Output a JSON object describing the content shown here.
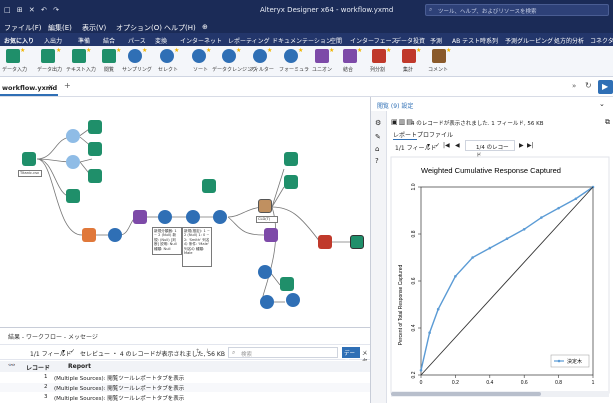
{
  "app": {
    "window_title": "Alteryx Designer x64 - workflow.yxmd",
    "search_placeholder": "ツール、ヘルプ、およびリソースを検索"
  },
  "menu": [
    "ファイル(F)",
    "編集(E)",
    "表示(V)",
    "オプション(O)",
    "ヘルプ(H)"
  ],
  "ribbon_tabs": [
    "お気に入り",
    "入出力",
    "準備",
    "結合",
    "パース",
    "変換",
    "インターネット",
    "レポーティング",
    "ドキュメンテーション",
    "空間",
    "インターフェース",
    "データ投資",
    "予測",
    "AB テスト",
    "時系列",
    "予測グルーピング",
    "処方的分析",
    "コネクター"
  ],
  "palette_tools": [
    "データ入力",
    "データ出力",
    "テキスト入力",
    "閲覧",
    "サンプリング",
    "セレクト",
    "ソート",
    "データクレンジング",
    "フィルター",
    "フォーミュラ",
    "ユニオン",
    "結合",
    "列分割",
    "集計",
    "コメント"
  ],
  "doc_tab": "workflow.yxmd",
  "canvas": {
    "input_node_label": "Titanic.csv",
    "annotation_1": "新規分類器: 1 ~ 2 (Null) 新規: (Null) [判断] 説明: Null 種類: Null",
    "annotation_2": "新規(推定): 1 ~ 2 (Null) 1: 0 ~ 2: 'Smith' 列名の 条件: 'Male' 列名の 種類: Male",
    "annotation_3": "CLD(T)"
  },
  "results": {
    "pane_title": "結果 - ワークフロー - メッセージ",
    "field_selector": "1/1 フィールド",
    "status_text": "セレビュー ・ 4 のレコードが表示されました, 56 KB",
    "search_placeholder": "検索",
    "data_button": "データ",
    "meta_button": "メタ",
    "col_record": "レコード",
    "col_report": "Report",
    "rows": [
      {
        "num": "1",
        "text": "(Multiple Sources): 閲覧ツールレポートタブを表示"
      },
      {
        "num": "2",
        "text": "(Multiple Sources): 閲覧ツールレポートタブを表示"
      },
      {
        "num": "3",
        "text": "(Multiple Sources): 閲覧ツールレポートタブを表示"
      }
    ]
  },
  "config": {
    "breadcrumb": "閲覧 (9) 設定",
    "status_text": "4 のレコードが表示されました. 1 フィールド, 56 KB",
    "tab_report": "レポート",
    "tab_profile": "プロファイル",
    "field_selector": "1/1 フィールド",
    "record_pager": "1/4 のレコード"
  },
  "chart_data": {
    "type": "line",
    "title": "Weighted Cumulative Response Captured",
    "xlabel": "",
    "ylabel": "Percent of Total Response Captured",
    "xlim": [
      0,
      1
    ],
    "ylim": [
      0.2,
      1.0
    ],
    "x_ticks": [
      "0",
      "0.2",
      "0.4",
      "0.6",
      "0.8",
      "1"
    ],
    "y_ticks": [
      "0.2",
      "0.4",
      "0.6",
      "0.8",
      "1.0"
    ],
    "grid": false,
    "legend_position": "bottom-right",
    "series": [
      {
        "name": "決定木",
        "color": "#5b9bd5",
        "x": [
          0.0,
          0.05,
          0.1,
          0.2,
          0.3,
          0.4,
          0.5,
          0.6,
          0.7,
          0.8,
          0.9,
          1.0
        ],
        "y": [
          0.22,
          0.38,
          0.48,
          0.62,
          0.7,
          0.74,
          0.78,
          0.82,
          0.87,
          0.91,
          0.95,
          1.0
        ]
      },
      {
        "name": "",
        "color": "#333333",
        "x": [
          0.0,
          1.0
        ],
        "y": [
          0.2,
          1.0
        ]
      }
    ]
  }
}
